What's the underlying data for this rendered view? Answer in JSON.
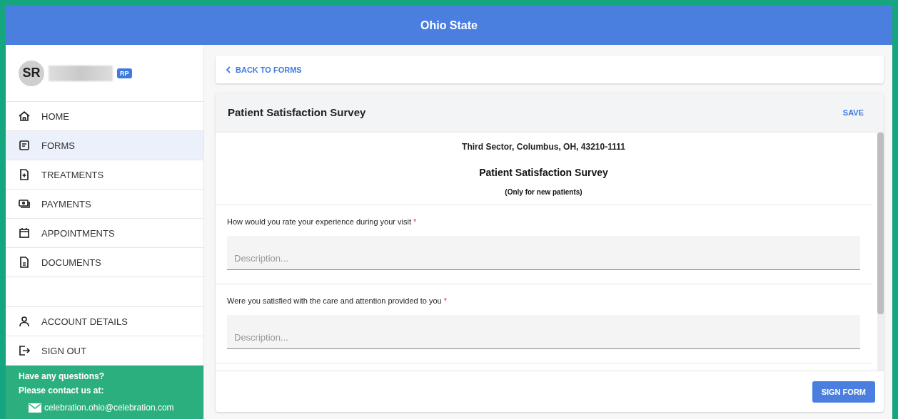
{
  "header": {
    "title": "Ohio State"
  },
  "user": {
    "initials": "SR",
    "badge": "RP"
  },
  "nav": [
    {
      "label": "HOME",
      "selected": false
    },
    {
      "label": "FORMS",
      "selected": true
    },
    {
      "label": "TREATMENTS",
      "selected": false
    },
    {
      "label": "PAYMENTS",
      "selected": false
    },
    {
      "label": "APPOINTMENTS",
      "selected": false
    },
    {
      "label": "DOCUMENTS",
      "selected": false
    }
  ],
  "account_nav": [
    {
      "label": "ACCOUNT DETAILS",
      "selected": false
    },
    {
      "label": "SIGN OUT",
      "selected": false
    }
  ],
  "contact": {
    "lines": [
      "Have any questions?",
      "Please contact us at:"
    ],
    "email": "celebration.ohio@celebration.com"
  },
  "back_link": "BACK TO FORMS",
  "form": {
    "title": "Patient Satisfaction Survey",
    "save": "SAVE",
    "address": "Third Sector, Columbus, OH, 43210-1111",
    "heading": "Patient Satisfaction Survey",
    "subheading": "(Only for new patients)",
    "questions": [
      {
        "label": "How would you rate your experience during your visit",
        "required_mark": "*",
        "placeholder": "Description..."
      },
      {
        "label": "Were you satisfied with the care and attention provided to you",
        "required_mark": "*",
        "placeholder": "Description..."
      }
    ],
    "sign": "SIGN FORM"
  }
}
